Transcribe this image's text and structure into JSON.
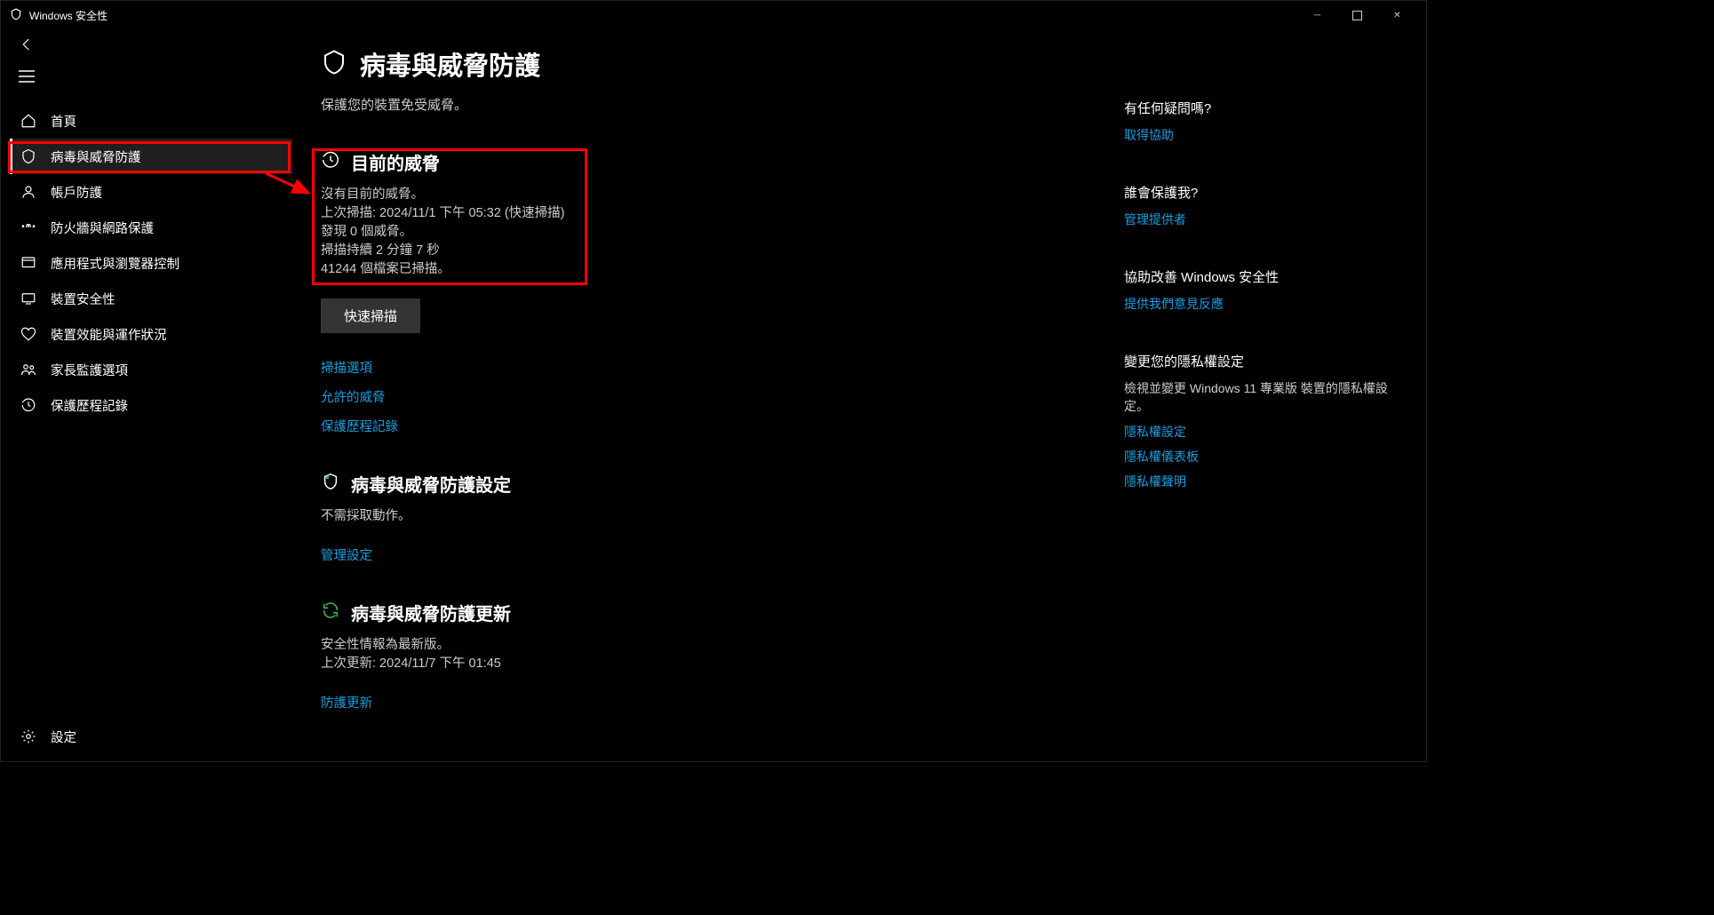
{
  "window_title": "Windows 安全性",
  "nav": {
    "home": "首頁",
    "virus": "病毒與威脅防護",
    "account": "帳戶防護",
    "firewall": "防火牆與網路保護",
    "appbrowser": "應用程式與瀏覽器控制",
    "devicesec": "裝置安全性",
    "deviceperf": "裝置效能與運作狀況",
    "family": "家長監護選項",
    "history": "保護歷程記錄",
    "settings": "設定"
  },
  "page": {
    "title": "病毒與威脅防護",
    "subtitle": "保護您的裝置免受威脅。"
  },
  "current_threats": {
    "title": "目前的威脅",
    "none": "沒有目前的威脅。",
    "last_scan": "上次掃描: 2024/11/1 下午 05:32 (快速掃描)",
    "found": "發現 0 個威脅。",
    "duration": "掃描持續 2 分鐘 7 秒",
    "files": "41244 個檔案已掃描。",
    "quick_scan": "快速掃描",
    "scan_options": "掃描選項",
    "allowed": "允許的威脅",
    "history": "保護歷程記錄"
  },
  "settings_sec": {
    "title": "病毒與威脅防護設定",
    "status": "不需採取動作。",
    "manage": "管理設定"
  },
  "updates_sec": {
    "title": "病毒與威脅防護更新",
    "status": "安全性情報為最新版。",
    "last_update": "上次更新: 2024/11/7 下午 01:45",
    "link": "防護更新"
  },
  "right": {
    "q_title": "有任何疑問嗎?",
    "q_link": "取得協助",
    "who_title": "誰會保護我?",
    "who_link": "管理提供者",
    "improve_title": "協助改善 Windows 安全性",
    "improve_link": "提供我們意見反應",
    "privacy_title": "變更您的隱私權設定",
    "privacy_text": "檢視並變更 Windows 11 專業版 裝置的隱私權設定。",
    "privacy_link1": "隱私權設定",
    "privacy_link2": "隱私權儀表板",
    "privacy_link3": "隱私權聲明"
  }
}
